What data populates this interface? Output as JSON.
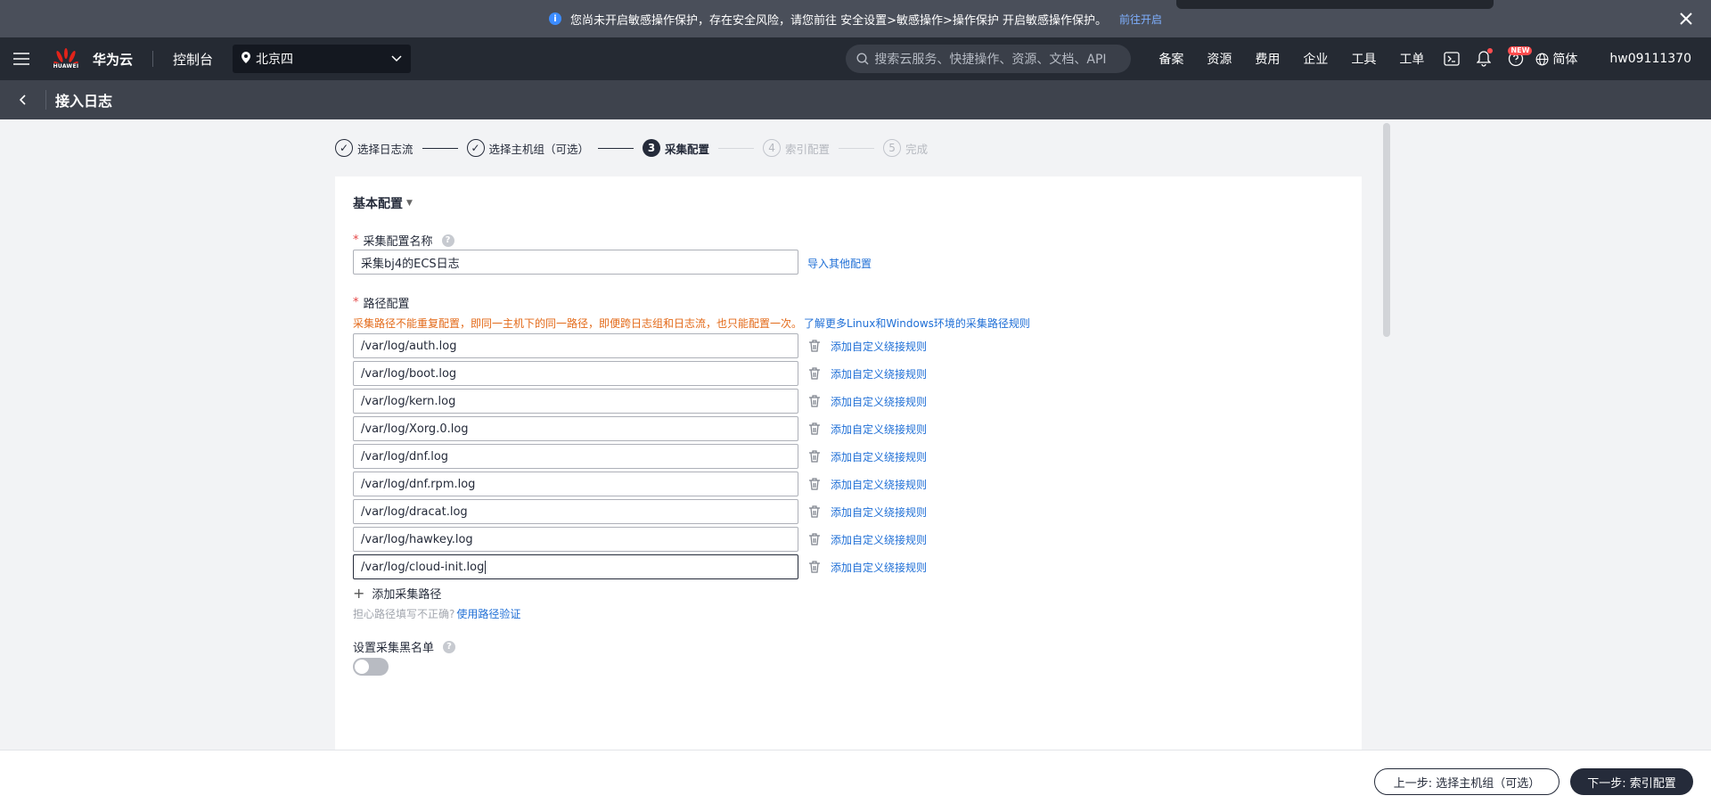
{
  "notice": {
    "text": "您尚未开启敏感操作保护，存在安全风险，请您前往 安全设置>敏感操作>操作保护 开启敏感操作保护。",
    "link": "前往开启"
  },
  "topnav": {
    "brand_sub": "HUAWEI",
    "brand": "华为云",
    "console": "控制台",
    "region": "北京四",
    "search_placeholder": "搜索云服务、快捷操作、资源、文档、API",
    "items": [
      "备案",
      "资源",
      "费用",
      "企业",
      "工具",
      "工单"
    ],
    "new_badge": "NEW",
    "language": "简体",
    "username": "hw09111370"
  },
  "subheader": {
    "title": "接入日志"
  },
  "steps": [
    {
      "num": "✓",
      "label": "选择日志流",
      "state": "done"
    },
    {
      "num": "✓",
      "label": "选择主机组（可选）",
      "state": "done"
    },
    {
      "num": "3",
      "label": "采集配置",
      "state": "active"
    },
    {
      "num": "4",
      "label": "索引配置",
      "state": "todo"
    },
    {
      "num": "5",
      "label": "完成",
      "state": "todo"
    }
  ],
  "form": {
    "section_title": "基本配置",
    "req_mark": "*",
    "help_mark": "?",
    "name_label": "采集配置名称",
    "name_value": "采集bj4的ECS日志",
    "import_link": "导入其他配置",
    "path_label": "路径配置",
    "path_warning": "采集路径不能重复配置，即同一主机下的同一路径，即便跨日志组和日志流，也只能配置一次。",
    "path_rule_link": "了解更多Linux和Windows环境的采集路径规则",
    "paths": [
      "/var/log/auth.log",
      "/var/log/boot.log",
      "/var/log/kern.log",
      "/var/log/Xorg.0.log",
      "/var/log/dnf.log",
      "/var/log/dnf.rpm.log",
      "/var/log/dracat.log",
      "/var/log/hawkey.log",
      "/var/log/cloud-init.log"
    ],
    "row_action": "添加自定义绕接规则",
    "add_path": "添加采集路径",
    "hint_text": "担心路径填写不正确?",
    "hint_link": "使用路径验证",
    "blacklist_label": "设置采集黑名单"
  },
  "footer": {
    "prev": "上一步: 选择主机组（可选）",
    "next": "下一步: 索引配置"
  }
}
